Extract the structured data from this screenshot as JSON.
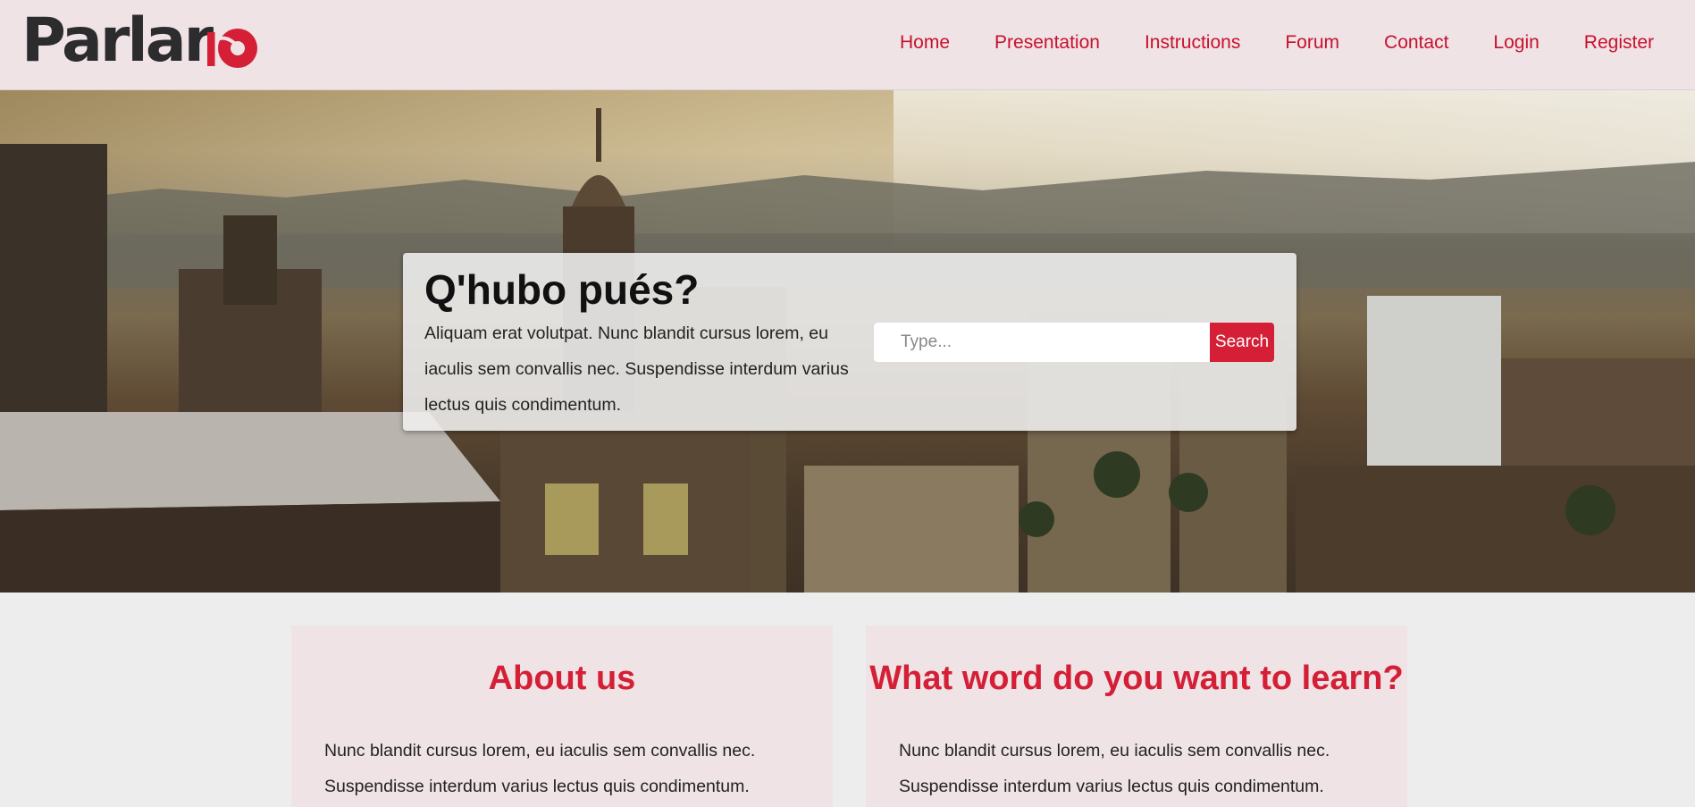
{
  "brand": {
    "logo_text": "Parlar",
    "accent": "#d41f36",
    "dark": "#2c2c2e"
  },
  "nav": {
    "items": [
      {
        "label": "Home"
      },
      {
        "label": "Presentation"
      },
      {
        "label": "Instructions"
      },
      {
        "label": "Forum"
      },
      {
        "label": "Contact"
      },
      {
        "label": "Login"
      },
      {
        "label": "Register"
      }
    ]
  },
  "hero": {
    "title": "Q'hubo pués?",
    "text": "Aliquam erat volutpat. Nunc blandit cursus lorem, eu iaculis sem convallis nec. Suspendisse interdum varius lectus quis condimentum.",
    "search": {
      "placeholder": "Type...",
      "button_label": "Search"
    }
  },
  "cards": [
    {
      "title": "About us",
      "text": "Nunc blandit cursus lorem, eu iaculis sem convallis nec. Suspendisse interdum varius lectus quis condimentum."
    },
    {
      "title": "What word do you want to learn?",
      "text": "Nunc blandit cursus lorem, eu iaculis sem convallis nec. Suspendisse interdum varius lectus quis condimentum."
    }
  ],
  "colors": {
    "header_bg": "#efe3e5",
    "page_bg": "#eeeded",
    "nav_link": "#c8102e"
  }
}
